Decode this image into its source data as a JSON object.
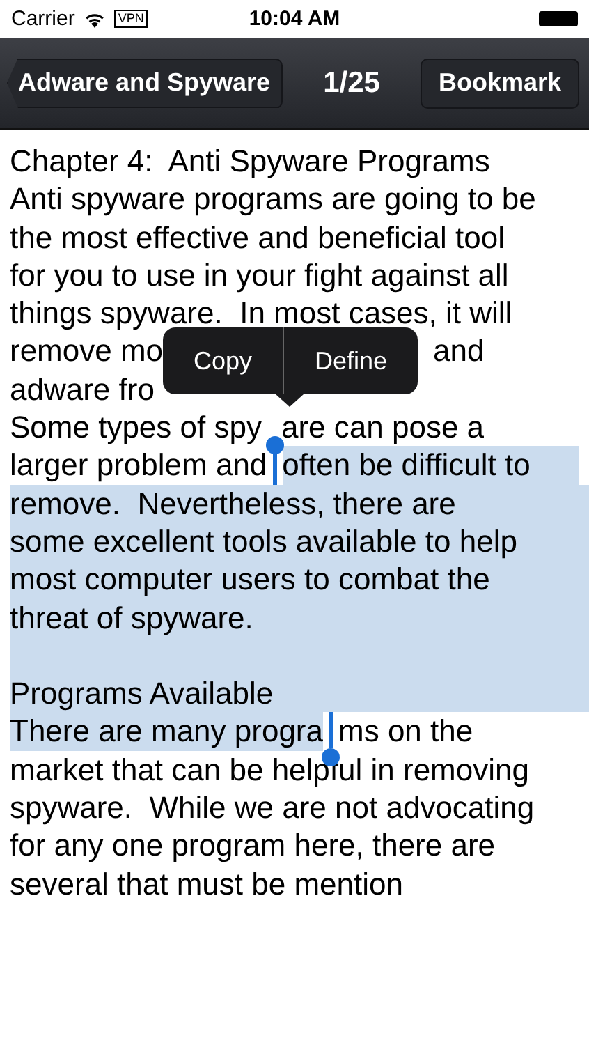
{
  "status_bar": {
    "carrier": "Carrier",
    "vpn": "VPN",
    "time": "10:04 AM"
  },
  "nav_bar": {
    "back_button": "Adware and Spyware",
    "page": "1/25",
    "bookmark_button": "Bookmark"
  },
  "lines": [
    {
      "selected": false,
      "segments": [
        {
          "kind": "text",
          "text": "Chapter 4:  Anti Spyware Programs",
          "selected": false
        }
      ]
    },
    {
      "selected": false,
      "segments": [
        {
          "kind": "text",
          "text": "Anti spyware programs are going to be",
          "selected": false
        }
      ]
    },
    {
      "selected": false,
      "segments": [
        {
          "kind": "text",
          "text": "the most effective and beneficial tool",
          "selected": false
        }
      ]
    },
    {
      "selected": false,
      "segments": [
        {
          "kind": "text",
          "text": "for you to use in your fight against all",
          "selected": false
        }
      ]
    },
    {
      "selected": false,
      "segments": [
        {
          "kind": "text",
          "text": "things spyware.  In most cases, it will",
          "selected": false
        }
      ]
    },
    {
      "selected": false,
      "segments": [
        {
          "kind": "text",
          "text": "remove mo",
          "selected": false
        },
        {
          "kind": "menu_gap"
        },
        {
          "kind": "text",
          "text": "and",
          "selected": false
        }
      ]
    },
    {
      "selected": false,
      "segments": [
        {
          "kind": "text",
          "text": "adware fro",
          "selected": false
        }
      ]
    },
    {
      "selected": false,
      "segments": [
        {
          "kind": "text",
          "text": "Some types of spy",
          "selected": false
        },
        {
          "kind": "handle_gap"
        },
        {
          "kind": "text",
          "text": "are can pose a",
          "selected": false
        }
      ]
    },
    {
      "selected": false,
      "segments": [
        {
          "kind": "text",
          "text": "larger problem and",
          "selected": false
        },
        {
          "kind": "start_handle"
        },
        {
          "kind": "text",
          "text": "often be difficult to",
          "selected": true
        }
      ]
    },
    {
      "selected": true,
      "segments": [
        {
          "kind": "text",
          "text": "remove.  Nevertheless, there are",
          "selected": true
        }
      ]
    },
    {
      "selected": true,
      "segments": [
        {
          "kind": "text",
          "text": "some excellent tools available to help",
          "selected": true
        }
      ]
    },
    {
      "selected": true,
      "segments": [
        {
          "kind": "text",
          "text": "most computer users to combat the",
          "selected": true
        }
      ]
    },
    {
      "selected": true,
      "segments": [
        {
          "kind": "text",
          "text": "threat of spyware.",
          "selected": true
        }
      ]
    },
    {
      "selected": true
    },
    {
      "selected": true,
      "segments": [
        {
          "kind": "text",
          "text": "Programs Available",
          "selected": true
        }
      ]
    },
    {
      "selected": false,
      "segments": [
        {
          "kind": "text",
          "text": "There are many progra",
          "selected": true
        },
        {
          "kind": "end_handle"
        },
        {
          "kind": "text",
          "text": "ms on the",
          "selected": false
        }
      ]
    },
    {
      "selected": false,
      "segments": [
        {
          "kind": "text",
          "text": "market that can be helpful in removing",
          "selected": false
        }
      ]
    },
    {
      "selected": false,
      "segments": [
        {
          "kind": "text",
          "text": "spyware.  While we are not advocating",
          "selected": false
        }
      ]
    },
    {
      "selected": false,
      "segments": [
        {
          "kind": "text",
          "text": "for any one program here, there are",
          "selected": false
        }
      ]
    },
    {
      "selected": false,
      "segments": [
        {
          "kind": "text",
          "text": "several that must be mention",
          "selected": false
        }
      ]
    }
  ],
  "edit_menu": [
    "Copy",
    "Define"
  ]
}
